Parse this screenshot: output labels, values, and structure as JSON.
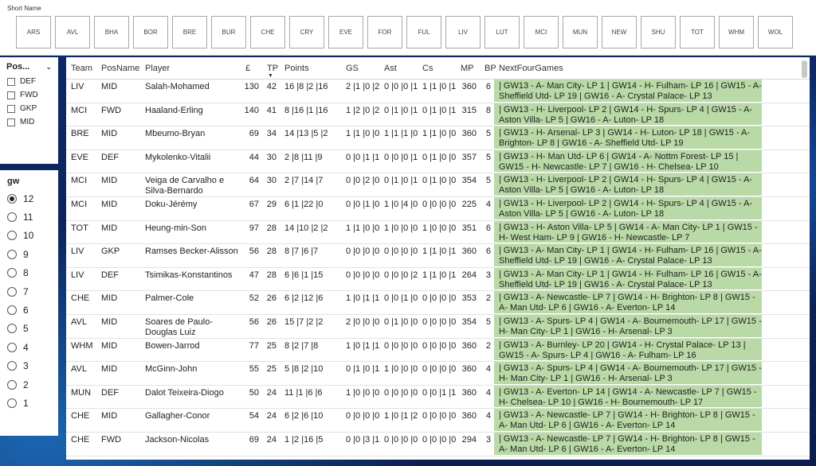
{
  "short_name_slicer": {
    "title": "Short Name",
    "teams": [
      "ARS",
      "AVL",
      "BHA",
      "BOR",
      "BRE",
      "BUR",
      "CHE",
      "CRY",
      "EVE",
      "FOR",
      "FUL",
      "LIV",
      "LUT",
      "MCI",
      "MUN",
      "NEW",
      "SHU",
      "TOT",
      "WHM",
      "WOL"
    ]
  },
  "pos_slicer": {
    "title": "Pos...",
    "options": [
      "DEF",
      "FWD",
      "GKP",
      "MID"
    ]
  },
  "gw_slicer": {
    "title": "gw",
    "options": [
      "12",
      "11",
      "10",
      "9",
      "8",
      "7",
      "6",
      "5",
      "4",
      "3",
      "2",
      "1"
    ],
    "selected": "12"
  },
  "table": {
    "headers": {
      "team": "Team",
      "pos": "PosName",
      "player": "Player",
      "price": "£",
      "tp": "TP",
      "points": "Points",
      "gs": "GS",
      "ast": "Ast",
      "cs": "Cs",
      "mp": "MP",
      "bp": "BP",
      "next": "NextFourGames"
    },
    "rows": [
      {
        "team": "LIV",
        "pos": "MID",
        "player": "Salah-Mohamed",
        "price": "130",
        "tp": "42",
        "points": "16 |8 |2 |16",
        "gs": "2 |1 |0 |2",
        "ast": "0 |0 |0 |1",
        "cs": "1 |1 |0 |1",
        "mp": "360",
        "bp": "6",
        "next": "| GW13 - A- Man City- LP 1 | GW14 - H- Fulham- LP 16 | GW15 - A- Sheffield Utd- LP 19 | GW16 - A- Crystal Palace- LP 13"
      },
      {
        "team": "MCI",
        "pos": "FWD",
        "player": "Haaland-Erling",
        "price": "140",
        "tp": "41",
        "points": "8 |16 |1 |16",
        "gs": "1 |2 |0 |2",
        "ast": "0 |1 |0 |1",
        "cs": "0 |1 |0 |1",
        "mp": "315",
        "bp": "8",
        "next": "| GW13 - H- Liverpool- LP 2 | GW14 - H- Spurs- LP 4 | GW15 - A- Aston Villa- LP 5 | GW16 - A- Luton- LP 18"
      },
      {
        "team": "BRE",
        "pos": "MID",
        "player": "Mbeumo-Bryan",
        "price": "69",
        "tp": "34",
        "points": "14 |13 |5 |2",
        "gs": "1 |1 |0 |0",
        "ast": "1 |1 |1 |0",
        "cs": "1 |1 |0 |0",
        "mp": "360",
        "bp": "5",
        "next": "| GW13 - H- Arsenal- LP 3 | GW14 - H- Luton- LP 18 | GW15 - A- Brighton- LP 8 | GW16 - A- Sheffield Utd- LP 19"
      },
      {
        "team": "EVE",
        "pos": "DEF",
        "player": "Mykolenko-Vitalii",
        "price": "44",
        "tp": "30",
        "points": "2 |8 |11 |9",
        "gs": "0 |0 |1 |1",
        "ast": "0 |0 |0 |1",
        "cs": "0 |1 |0 |0",
        "mp": "357",
        "bp": "5",
        "next": "| GW13 - H- Man Utd- LP 6 | GW14 - A- Nottm Forest- LP 15 | GW15 - H- Newcastle- LP 7 | GW16 - H- Chelsea- LP 10"
      },
      {
        "team": "MCI",
        "pos": "MID",
        "player": "Veiga de Carvalho e Silva-Bernardo",
        "price": "64",
        "tp": "30",
        "points": "2 |7 |14 |7",
        "gs": "0 |0 |2 |0",
        "ast": "0 |1 |0 |1",
        "cs": "0 |1 |0 |0",
        "mp": "354",
        "bp": "5",
        "next": "| GW13 - H- Liverpool- LP 2 | GW14 - H- Spurs- LP 4 | GW15 - A- Aston Villa- LP 5 | GW16 - A- Luton- LP 18"
      },
      {
        "team": "MCI",
        "pos": "MID",
        "player": "Doku-Jérémy",
        "price": "67",
        "tp": "29",
        "points": "6 |1 |22 |0",
        "gs": "0 |0 |1 |0",
        "ast": "1 |0 |4 |0",
        "cs": "0 |0 |0 |0",
        "mp": "225",
        "bp": "4",
        "next": "| GW13 - H- Liverpool- LP 2 | GW14 - H- Spurs- LP 4 | GW15 - A- Aston Villa- LP 5 | GW16 - A- Luton- LP 18"
      },
      {
        "team": "TOT",
        "pos": "MID",
        "player": "Heung-min-Son",
        "price": "97",
        "tp": "28",
        "points": "14 |10 |2 |2",
        "gs": "1 |1 |0 |0",
        "ast": "1 |0 |0 |0",
        "cs": "1 |0 |0 |0",
        "mp": "351",
        "bp": "6",
        "next": "| GW13 - H- Aston Villa- LP 5 | GW14 - A- Man City- LP 1 | GW15 - H- West Ham- LP 9 | GW16 - H- Newcastle- LP 7"
      },
      {
        "team": "LIV",
        "pos": "GKP",
        "player": "Ramses Becker-Alisson",
        "price": "56",
        "tp": "28",
        "points": "8 |7 |6 |7",
        "gs": "0 |0 |0 |0",
        "ast": "0 |0 |0 |0",
        "cs": "1 |1 |0 |1",
        "mp": "360",
        "bp": "6",
        "next": "| GW13 - A- Man City- LP 1 | GW14 - H- Fulham- LP 16 | GW15 - A- Sheffield Utd- LP 19 | GW16 - A- Crystal Palace- LP 13"
      },
      {
        "team": "LIV",
        "pos": "DEF",
        "player": "Tsimikas-Konstantinos",
        "price": "47",
        "tp": "28",
        "points": "6 |6 |1 |15",
        "gs": "0 |0 |0 |0",
        "ast": "0 |0 |0 |2",
        "cs": "1 |1 |0 |1",
        "mp": "264",
        "bp": "3",
        "next": "| GW13 - A- Man City- LP 1 | GW14 - H- Fulham- LP 16 | GW15 - A- Sheffield Utd- LP 19 | GW16 - A- Crystal Palace- LP 13"
      },
      {
        "team": "CHE",
        "pos": "MID",
        "player": "Palmer-Cole",
        "price": "52",
        "tp": "26",
        "points": "6 |2 |12 |6",
        "gs": "1 |0 |1 |1",
        "ast": "0 |0 |1 |0",
        "cs": "0 |0 |0 |0",
        "mp": "353",
        "bp": "2",
        "next": "| GW13 - A- Newcastle- LP 7 | GW14 - H- Brighton- LP 8 | GW15 - A- Man Utd- LP 6 | GW16 - A- Everton- LP 14"
      },
      {
        "team": "AVL",
        "pos": "MID",
        "player": "Soares de Paulo-Douglas Luiz",
        "price": "56",
        "tp": "26",
        "points": "15 |7 |2 |2",
        "gs": "2 |0 |0 |0",
        "ast": "0 |1 |0 |0",
        "cs": "0 |0 |0 |0",
        "mp": "354",
        "bp": "5",
        "next": "| GW13 - A- Spurs- LP 4 | GW14 - A- Bournemouth- LP 17 | GW15 - H- Man City- LP 1 | GW16 - H- Arsenal- LP 3"
      },
      {
        "team": "WHM",
        "pos": "MID",
        "player": "Bowen-Jarrod",
        "price": "77",
        "tp": "25",
        "points": "8 |2 |7 |8",
        "gs": "1 |0 |1 |1",
        "ast": "0 |0 |0 |0",
        "cs": "0 |0 |0 |0",
        "mp": "360",
        "bp": "2",
        "next": "| GW13 - A- Burnley- LP 20 | GW14 - H- Crystal Palace- LP 13 | GW15 - A- Spurs- LP 4 | GW16 - A- Fulham- LP 16"
      },
      {
        "team": "AVL",
        "pos": "MID",
        "player": "McGinn-John",
        "price": "55",
        "tp": "25",
        "points": "5 |8 |2 |10",
        "gs": "0 |1 |0 |1",
        "ast": "1 |0 |0 |0",
        "cs": "0 |0 |0 |0",
        "mp": "360",
        "bp": "4",
        "next": "| GW13 - A- Spurs- LP 4 | GW14 - A- Bournemouth- LP 17 | GW15 - H- Man City- LP 1 | GW16 - H- Arsenal- LP 3"
      },
      {
        "team": "MUN",
        "pos": "DEF",
        "player": "Dalot Teixeira-Diogo",
        "price": "50",
        "tp": "24",
        "points": "11 |1 |6 |6",
        "gs": "1 |0 |0 |0",
        "ast": "0 |0 |0 |0",
        "cs": "0 |0 |1 |1",
        "mp": "360",
        "bp": "4",
        "next": "| GW13 - A- Everton- LP 14 | GW14 - A- Newcastle- LP 7 | GW15 - H- Chelsea- LP 10 | GW16 - H- Bournemouth- LP 17"
      },
      {
        "team": "CHE",
        "pos": "MID",
        "player": "Gallagher-Conor",
        "price": "54",
        "tp": "24",
        "points": "6 |2 |6 |10",
        "gs": "0 |0 |0 |0",
        "ast": "1 |0 |1 |2",
        "cs": "0 |0 |0 |0",
        "mp": "360",
        "bp": "4",
        "next": "| GW13 - A- Newcastle- LP 7 | GW14 - H- Brighton- LP 8 | GW15 - A- Man Utd- LP 6 | GW16 - A- Everton- LP 14"
      },
      {
        "team": "CHE",
        "pos": "FWD",
        "player": "Jackson-Nicolas",
        "price": "69",
        "tp": "24",
        "points": "1 |2 |16 |5",
        "gs": "0 |0 |3 |1",
        "ast": "0 |0 |0 |0",
        "cs": "0 |0 |0 |0",
        "mp": "294",
        "bp": "3",
        "next": "| GW13 - A- Newcastle- LP 7 | GW14 - H- Brighton- LP 8 | GW15 - A- Man Utd- LP 6 | GW16 - A- Everton- LP 14"
      }
    ]
  },
  "colors": {
    "next_games_bg": "#b9d9a6",
    "page_bg": "#0d2357"
  }
}
